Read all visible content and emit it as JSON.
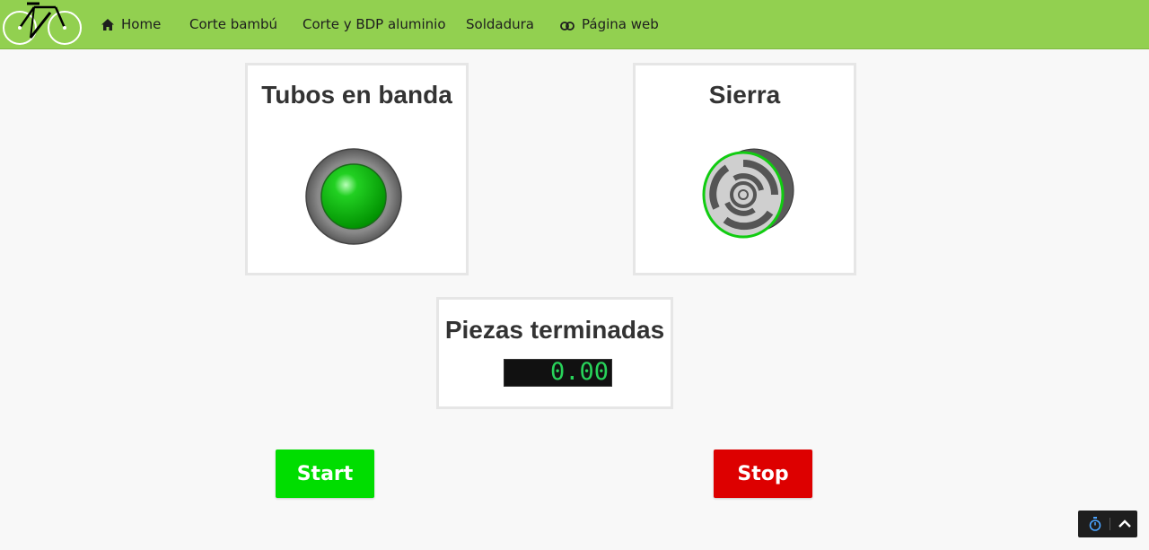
{
  "nav": {
    "items": [
      {
        "label": "Home",
        "icon": "home-icon"
      },
      {
        "label": "Corte bambú"
      },
      {
        "label": "Corte y BDP aluminio"
      },
      {
        "label": "Soldadura"
      },
      {
        "label": "Página web",
        "icon": "link-icon"
      }
    ]
  },
  "panels": {
    "tubes": {
      "title": "Tubos en banda",
      "indicator_color": "#00b000",
      "state": "on"
    },
    "saw": {
      "title": "Sierra",
      "indicator_color": "#00c000",
      "state": "running"
    },
    "pieces": {
      "title": "Piezas terminadas",
      "value": "0.00"
    }
  },
  "controls": {
    "start_label": "Start",
    "start_color": "#00dd00",
    "stop_label": "Stop",
    "stop_color": "#dd0000"
  },
  "float_toolbar": {
    "icons": [
      "timer-icon",
      "chevron-up-icon"
    ]
  }
}
